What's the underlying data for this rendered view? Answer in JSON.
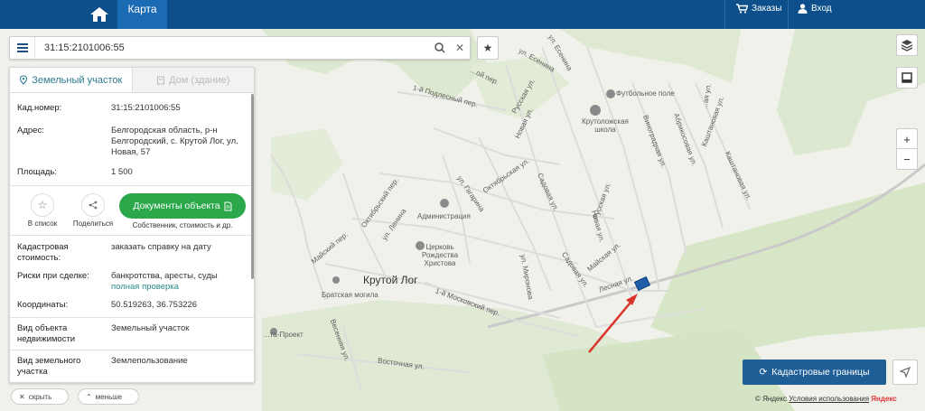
{
  "header": {
    "map_tab": "Карта",
    "orders_label": "Заказы",
    "login_label": "Вход"
  },
  "search": {
    "value": "31:15:2101006:55"
  },
  "tabs": {
    "land": "Земельный участок",
    "house": "Дом (здание)"
  },
  "details": {
    "cadastral_number_label": "Кад.номер:",
    "cadastral_number_value": "31:15:2101006:55",
    "address_label": "Адрес:",
    "address_value": "Белгородская область, р-н Белгородский, с. Крутой Лог, ул. Новая, 57",
    "area_label": "Площадь:",
    "area_value": "1 500",
    "cost_label": "Кадастровая стоимость:",
    "cost_link": "заказать справку на дату",
    "risks_label": "Риски при сделке:",
    "risks_value": "банкротства, аресты, суды",
    "risks_link": "полная проверка",
    "coords_label": "Координаты:",
    "coords_value": "50.519263, 36.753226",
    "property_type_label": "Вид объекта недвижимости",
    "property_type_value": "Земельный участок",
    "land_type_label": "Вид земельного участка",
    "land_type_value": "Землепользование"
  },
  "actions": {
    "to_list": "В список",
    "share": "Поделиться",
    "documents": "Документы объекта",
    "documents_sub": "Собственник, стоимость и др."
  },
  "bottom": {
    "hide": "скрыть",
    "less": "меньше"
  },
  "map": {
    "cadastral_button": "Кадастровые границы",
    "copyright_prefix": "© Яндекс",
    "terms_link": "Условия использования",
    "yandex": "Яндекс",
    "zoom_in": "+",
    "zoom_out": "−",
    "village": "Крутой Лог",
    "labels": {
      "football": "Футбольное поле",
      "school": "Крутоложская школа",
      "admin": "Администрация",
      "church": "Церковь Рождества Христова",
      "grave": "Братская могила",
      "proekt": "...та-Проект",
      "esenina1": "ул. Есенина",
      "esenina2": "ул. Есенина",
      "russkaya": "Русская ул.",
      "novaya": "Новая ул.",
      "pervyi_pod": "1-й Подлесный пер.",
      "lugovoi": "...ой пер.",
      "vinogradnaya": "Виноградная ул.",
      "abrikosovaya": "Абрикосовая ул.",
      "kashtanovaya": "Каштановая ул.",
      "kashtanovaya2": "Каштановая ул.",
      "tsvetochnaya": "...ая ул.",
      "gagarina": "ул. Гагарина",
      "oktyabrskaya": "Октябрьская ул.",
      "sadovaya": "Садовая ул.",
      "oktyabrskiy": "Октябрьский пер.",
      "lenina": "ул. Ленина",
      "russkaya2": "Русская ул.",
      "novaya2": "Новая ул.",
      "mayskaya": "Майская ул.",
      "mayskiy": "Майский пер.",
      "lesnaya": "Лесная ул.",
      "mironova": "ул. Миронова",
      "moskovskiy": "1-й Московский пер.",
      "vesennyaya": "Весенняя ул.",
      "vostochnaya": "Восточная ул.",
      "sadovaya2": "Садовая ул."
    }
  },
  "colors": {
    "header": "#0d4f8a",
    "active_tab": "#1a6bb3",
    "docs_button": "#2aa84a",
    "cadastral_button": "#1f5e96",
    "parcel": "#1e5fa8",
    "arrow": "#d9342b"
  }
}
